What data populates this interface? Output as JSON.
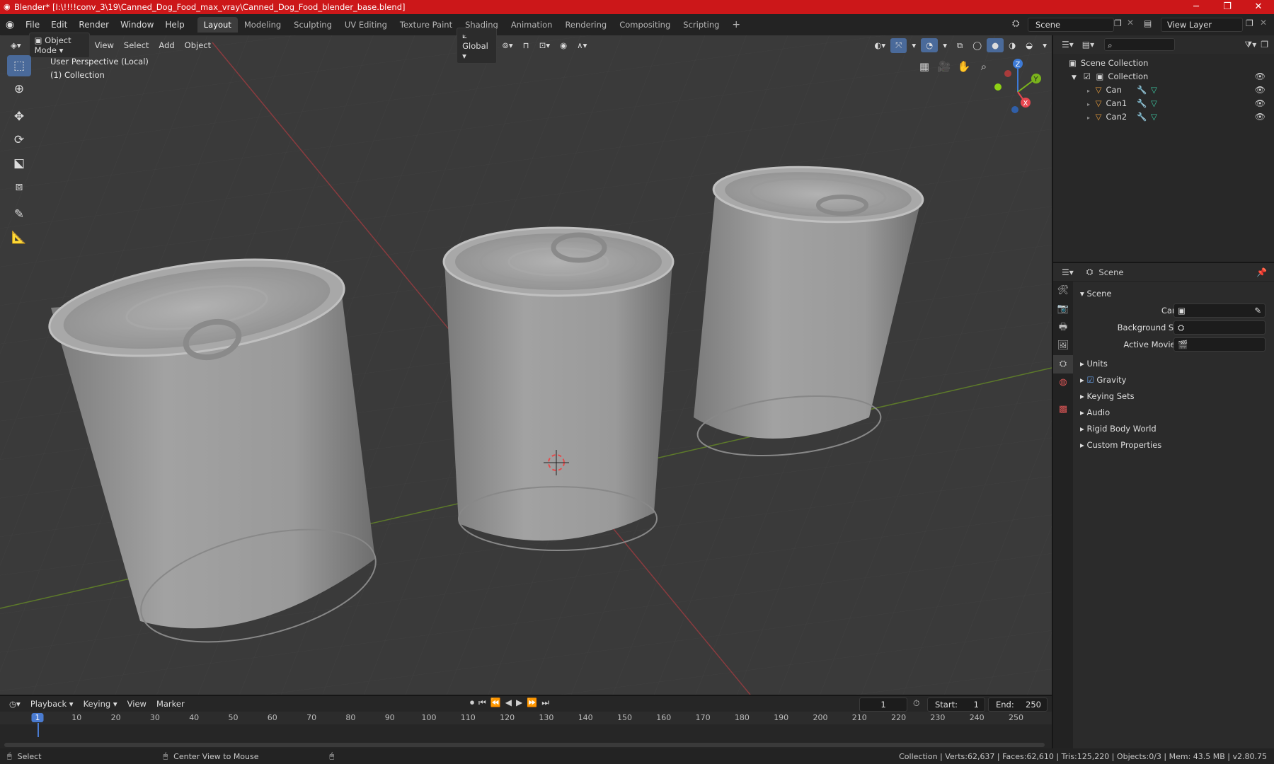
{
  "window": {
    "title": "Blender* [I:\\!!!!conv_3\\19\\Canned_Dog_Food_max_vray\\Canned_Dog_Food_blender_base.blend]"
  },
  "menu": [
    "File",
    "Edit",
    "Render",
    "Window",
    "Help"
  ],
  "workspaces": [
    "Layout",
    "Modeling",
    "Sculpting",
    "UV Editing",
    "Texture Paint",
    "Shading",
    "Animation",
    "Rendering",
    "Compositing",
    "Scripting"
  ],
  "scene_field": "Scene",
  "view_layer_field": "View Layer",
  "viewport": {
    "mode": "Object Mode",
    "menus": [
      "View",
      "Select",
      "Add",
      "Object"
    ],
    "orientation": "Global",
    "info_line1": "User Perspective (Local)",
    "info_line2": "(1) Collection",
    "axes": {
      "z": "Z",
      "y": "Y",
      "x": "X"
    }
  },
  "outliner": {
    "root": "Scene Collection",
    "collection": "Collection",
    "objects": [
      "Can",
      "Can1",
      "Can2"
    ]
  },
  "properties": {
    "header": "Scene",
    "panel": "Scene",
    "camera_label": "Camera",
    "background_label": "Background Scene",
    "movie_clip_label": "Active Movie Clip",
    "subpanels": [
      "Units",
      "Gravity",
      "Keying Sets",
      "Audio",
      "Rigid Body World",
      "Custom Properties"
    ]
  },
  "timeline": {
    "menus": [
      "Playback",
      "Keying",
      "View",
      "Marker"
    ],
    "current_frame": "1",
    "start_label": "Start:",
    "start": "1",
    "end_label": "End:",
    "end": "250",
    "ticks": [
      "1",
      "10",
      "20",
      "30",
      "40",
      "50",
      "60",
      "70",
      "80",
      "90",
      "100",
      "110",
      "120",
      "130",
      "140",
      "150",
      "160",
      "170",
      "180",
      "190",
      "200",
      "210",
      "220",
      "230",
      "240",
      "250"
    ]
  },
  "status": {
    "select": "Select",
    "center": "Center View to Mouse",
    "stats": "Collection | Verts:62,637 | Faces:62,610 | Tris:125,220 | Objects:0/3 | Mem: 43.5 MB | v2.80.75"
  },
  "colors": {
    "titlebar": "#cc1719",
    "accent": "#4a6a9a",
    "x_axis": "#e8464f",
    "y_axis": "#7ab31c",
    "z_axis": "#3d7ad6"
  }
}
